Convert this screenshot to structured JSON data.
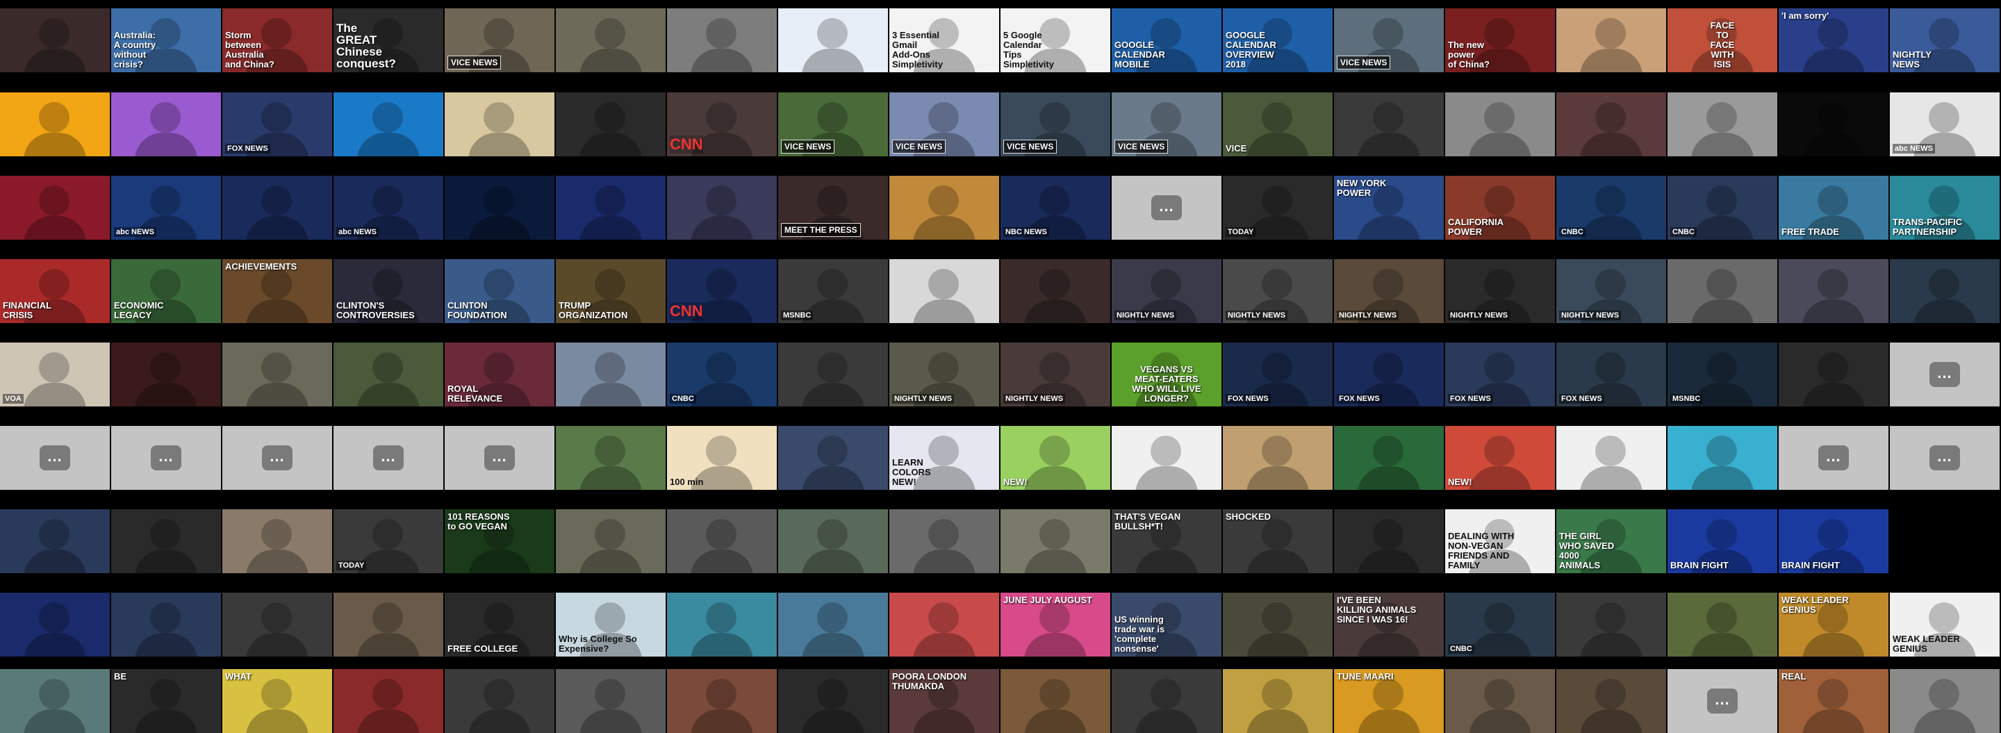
{
  "more_label": "...",
  "rows": [
    {
      "tiles": [
        {
          "color": "#3a2a2a"
        },
        {
          "color": "#3d6ea8",
          "caption": "Australia:\nA country\nwithout\ncrisis?"
        },
        {
          "color": "#8a2a2a",
          "caption": "Storm\nbetween\nAustralia\nand China?"
        },
        {
          "color": "#2a2a2a",
          "caption": "The\nGREAT\nChinese\nconquest?",
          "style": "big"
        },
        {
          "color": "#6f6655",
          "caption": "VICE NEWS",
          "style": "boxed"
        },
        {
          "color": "#6e6a5a"
        },
        {
          "color": "#7d7d7d"
        },
        {
          "color": "#e8eef7"
        },
        {
          "color": "#f3f3f3",
          "caption": "3 Essential\nGmail\nAdd-Ons\nSimpletivity",
          "style": "dark"
        },
        {
          "color": "#f3f3f3",
          "caption": "5 Google\nCalendar\nTips\nSimpletivity",
          "style": "dark"
        },
        {
          "color": "#1f5fa8",
          "caption": "GOOGLE\nCALENDAR\nMOBILE"
        },
        {
          "color": "#1f5fa8",
          "caption": "GOOGLE\nCALENDAR\nOVERVIEW\n2018"
        },
        {
          "color": "#5d6f7c",
          "caption": "VICE NEWS",
          "style": "boxed"
        },
        {
          "color": "#7a2020",
          "caption": "The new\npower\nof China?"
        },
        {
          "color": "#c9a078"
        },
        {
          "color": "#c0503a",
          "caption": "FACE\nTO\nFACE\nWITH\nISIS",
          "style": "center"
        },
        {
          "color": "#2a3f8a",
          "caption": "'I am sorry'",
          "style": "top"
        },
        {
          "color": "#3a5a9a",
          "caption": "NIGHTLY\nNEWS"
        }
      ]
    },
    {
      "tiles": [
        {
          "color": "#f2a515"
        },
        {
          "color": "#9a5ad0"
        },
        {
          "color": "#2a3a6a",
          "logo": "FOX NEWS"
        },
        {
          "color": "#1a7ac8"
        },
        {
          "color": "#d8c8a0"
        },
        {
          "color": "#2a2a2a"
        },
        {
          "color": "#4a3a3a",
          "logo": "CNN",
          "logo_style": "red"
        },
        {
          "color": "#4a6a3a",
          "caption": "VICE NEWS",
          "style": "boxed"
        },
        {
          "color": "#7a8ab0",
          "caption": "VICE NEWS",
          "style": "boxed"
        },
        {
          "color": "#3a4a5a",
          "caption": "VICE NEWS",
          "style": "boxed"
        },
        {
          "color": "#6a7a8a",
          "caption": "VICE NEWS",
          "style": "boxed"
        },
        {
          "color": "#4a5a3a",
          "caption": "VICE"
        },
        {
          "color": "#3a3a3a"
        },
        {
          "color": "#8a8a8a"
        },
        {
          "color": "#5a3a3a"
        },
        {
          "color": "#9a9a9a"
        },
        {
          "color": "#0a0a0a"
        },
        {
          "color": "#e6e6e6",
          "logo": "abc NEWS"
        }
      ]
    },
    {
      "tiles": [
        {
          "color": "#8a1a2a"
        },
        {
          "color": "#1a3a7a",
          "logo": "abc NEWS"
        },
        {
          "color": "#1a2a5a"
        },
        {
          "color": "#1a2a5a",
          "logo": "abc NEWS"
        },
        {
          "color": "#0a1a3a"
        },
        {
          "color": "#1a2a6a"
        },
        {
          "color": "#3a3a5a"
        },
        {
          "color": "#3a2a2a",
          "caption": "MEET THE PRESS",
          "style": "boxed"
        },
        {
          "color": "#c08a3a"
        },
        {
          "color": "#1a2a5a",
          "logo": "NBC NEWS"
        },
        {
          "more": true
        },
        {
          "color": "#2a2a2a",
          "logo": "TODAY"
        },
        {
          "color": "#2a4a8a",
          "caption": "NEW YORK\nPOWER",
          "style": "top"
        },
        {
          "color": "#8a3a2a",
          "caption": "CALIFORNIA\nPOWER"
        },
        {
          "color": "#1a3a6a",
          "logo": "CNBC"
        },
        {
          "color": "#2a3a5a",
          "logo": "CNBC"
        },
        {
          "color": "#3a7aa0",
          "caption": "FREE TRADE"
        },
        {
          "color": "#2a8a9a",
          "caption": "TRANS-PACIFIC\nPARTNERSHIP"
        }
      ]
    },
    {
      "tiles": [
        {
          "color": "#aa2a2a",
          "caption": "FINANCIAL\nCRISIS"
        },
        {
          "color": "#3a6a3a",
          "caption": "ECONOMIC\nLEGACY"
        },
        {
          "color": "#6a4a2a",
          "caption": "ACHIEVEMENTS",
          "style": "top"
        },
        {
          "color": "#2a2a3a",
          "caption": "CLINTON'S\nCONTROVERSIES"
        },
        {
          "color": "#3a5a8a",
          "caption": "CLINTON\nFOUNDATION"
        },
        {
          "color": "#5a4a2a",
          "caption": "TRUMP\nORGANIZATION"
        },
        {
          "color": "#1a2a5a",
          "logo": "CNN",
          "logo_style": "red"
        },
        {
          "color": "#3a3a3a",
          "logo": "MSNBC"
        },
        {
          "color": "#d8d8d8"
        },
        {
          "color": "#3a2a2a"
        },
        {
          "color": "#3a3a4a",
          "logo": "NIGHTLY NEWS"
        },
        {
          "color": "#4a4a4a",
          "logo": "NIGHTLY NEWS"
        },
        {
          "color": "#5a4a3a",
          "logo": "NIGHTLY NEWS"
        },
        {
          "color": "#2a2a2a",
          "logo": "NIGHTLY NEWS"
        },
        {
          "color": "#3a4a5a",
          "logo": "NIGHTLY NEWS"
        },
        {
          "color": "#6a6a6a"
        },
        {
          "color": "#4a4a5a"
        },
        {
          "color": "#2a3a4a"
        }
      ]
    },
    {
      "tiles": [
        {
          "color": "#cfc5b5",
          "logo": "VOA"
        },
        {
          "color": "#3a1a1a"
        },
        {
          "color": "#6a6a5a"
        },
        {
          "color": "#4a5a3a"
        },
        {
          "color": "#6a2a3a",
          "caption": "ROYAL\nRELEVANCE"
        },
        {
          "color": "#7a8aa0"
        },
        {
          "color": "#1a3a6a",
          "logo": "CNBC"
        },
        {
          "color": "#3a3a3a"
        },
        {
          "color": "#5a5a4a",
          "logo": "NIGHTLY NEWS"
        },
        {
          "color": "#4a3a3a",
          "logo": "NIGHTLY NEWS"
        },
        {
          "color": "#5aa02a",
          "caption": "VEGANS VS\nMEAT-EATERS\nWHO WILL LIVE LONGER?",
          "style": "center"
        },
        {
          "color": "#1a2a4a",
          "logo": "FOX NEWS"
        },
        {
          "color": "#1a2a5a",
          "logo": "FOX NEWS"
        },
        {
          "color": "#2a3a5a",
          "logo": "FOX NEWS"
        },
        {
          "color": "#2a3a4a",
          "logo": "FOX NEWS"
        },
        {
          "color": "#1a2a3a",
          "logo": "MSNBC"
        },
        {
          "color": "#2a2a2a"
        },
        {
          "more": true
        }
      ]
    },
    {
      "tiles": [
        {
          "more": true
        },
        {
          "more": true
        },
        {
          "more": true
        },
        {
          "more": true
        },
        {
          "more": true
        },
        {
          "color": "#5a7a4a"
        },
        {
          "color": "#f0e0c0",
          "caption": "100 min",
          "style": "dark"
        },
        {
          "color": "#3a4a6a"
        },
        {
          "color": "#e6e6f0",
          "caption": "LEARN\nCOLORS\nNEW!",
          "style": "dark"
        },
        {
          "color": "#9ad060",
          "caption": "NEW!"
        },
        {
          "color": "#f0f0f0"
        },
        {
          "color": "#c0a070"
        },
        {
          "color": "#2a6a3a"
        },
        {
          "color": "#d04a3a",
          "caption": "NEW!"
        },
        {
          "color": "#f0f0f0"
        },
        {
          "color": "#3ab0d0"
        },
        {
          "more": true
        },
        {
          "more": true
        }
      ]
    },
    {
      "tiles": [
        {
          "color": "#2a3a5a"
        },
        {
          "color": "#2a2a2a"
        },
        {
          "color": "#8a7a6a"
        },
        {
          "color": "#3a3a3a",
          "logo": "TODAY"
        },
        {
          "color": "#1a3a1a",
          "caption": "101 REASONS\nto GO VEGAN",
          "style": "top"
        },
        {
          "color": "#6a6a5a"
        },
        {
          "color": "#5a5a5a"
        },
        {
          "color": "#5a6a5a"
        },
        {
          "color": "#6a6a6a"
        },
        {
          "color": "#7a7a6a"
        },
        {
          "color": "#3a3a3a",
          "caption": "THAT'S VEGAN\nBULLSH*T!",
          "style": "top"
        },
        {
          "color": "#3a3a3a",
          "caption": "SHOCKED",
          "style": "top"
        },
        {
          "color": "#2a2a2a"
        },
        {
          "color": "#f0f0f0",
          "caption": "DEALING WITH\nNON-VEGAN\nFRIENDS AND\nFAMILY",
          "style": "dark"
        },
        {
          "color": "#3a7a4a",
          "caption": "THE GIRL\nWHO SAVED\n4000\nANIMALS"
        },
        {
          "color": "#1a3aa0",
          "caption": "BRAIN FIGHT"
        },
        {
          "color": "#1a3aa0",
          "caption": "BRAIN FIGHT"
        }
      ]
    },
    {
      "tiles": [
        {
          "color": "#1a2a6a"
        },
        {
          "color": "#2a3a5a"
        },
        {
          "color": "#3a3a3a"
        },
        {
          "color": "#6a5a4a"
        },
        {
          "color": "#2a2a2a",
          "caption": "FREE COLLEGE"
        },
        {
          "color": "#c8d8e0",
          "caption": "Why is College So Expensive?",
          "style": "dark"
        },
        {
          "color": "#3a8aa0"
        },
        {
          "color": "#4a7a9a"
        },
        {
          "color": "#c84a4a"
        },
        {
          "color": "#d84a8a",
          "caption": "JUNE JULY AUGUST",
          "style": "top"
        },
        {
          "color": "#3a4a6a",
          "caption": "US winning\ntrade war is\n'complete\nnonsense'"
        },
        {
          "color": "#4a4a3a"
        },
        {
          "color": "#4a3a3a",
          "caption": "I'VE BEEN\nKILLING ANIMALS\nSINCE I WAS 16!",
          "style": "top"
        },
        {
          "color": "#2a3a4a",
          "logo": "CNBC"
        },
        {
          "color": "#3a3a3a"
        },
        {
          "color": "#5a6a3a"
        },
        {
          "color": "#c08a2a",
          "caption": "WEAK LEADER GENIUS",
          "style": "top"
        },
        {
          "color": "#f0f0f0",
          "caption": "WEAK LEADER GENIUS",
          "style": "dark"
        }
      ]
    },
    {
      "tiles": [
        {
          "color": "#5a7a7a"
        },
        {
          "color": "#2a2a2a",
          "caption": "BE",
          "style": "top"
        },
        {
          "color": "#d8c040",
          "caption": "WHAT",
          "style": "top"
        },
        {
          "color": "#8a2a2a"
        },
        {
          "color": "#3a3a3a"
        },
        {
          "color": "#5a5a5a"
        },
        {
          "color": "#7a4a3a"
        },
        {
          "color": "#2a2a2a"
        },
        {
          "color": "#5a3a3a",
          "caption": "POORA LONDON\nTHUMAKDA",
          "style": "top"
        },
        {
          "color": "#7a5a3a"
        },
        {
          "color": "#3a3a3a"
        },
        {
          "color": "#c0a040"
        },
        {
          "color": "#d89a20",
          "caption": "TUNE MAARI",
          "style": "top"
        },
        {
          "color": "#6a5a4a"
        },
        {
          "color": "#5a4a3a"
        },
        {
          "more": true
        },
        {
          "color": "#a0603a",
          "caption": "REAL",
          "style": "top"
        },
        {
          "color": "#8a8a8a"
        }
      ]
    }
  ]
}
